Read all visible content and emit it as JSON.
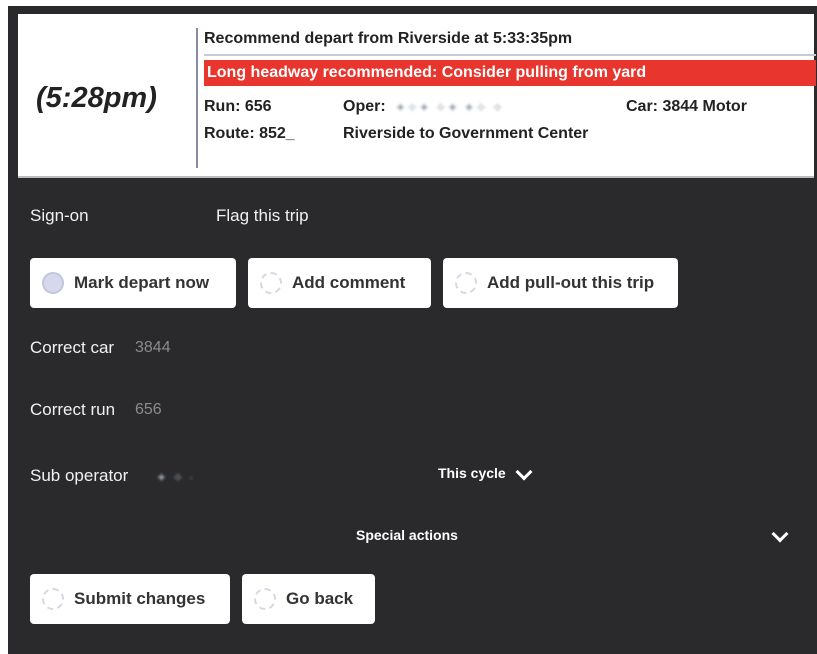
{
  "header": {
    "time": "(5:28pm)",
    "recommendation": "Recommend depart from Riverside at 5:33:35pm",
    "alert": "Long headway recommended: Consider pulling from yard",
    "run": "Run: 656",
    "oper_label": "Oper:",
    "car": "Car: 3844 Motor",
    "route": "Route: 852_",
    "route_name": "Riverside to Government Center"
  },
  "menu": {
    "sign_on": "Sign-on",
    "flag_trip": "Flag this trip"
  },
  "actions": {
    "mark_depart": "Mark depart now",
    "add_comment": "Add comment",
    "add_pullout": "Add pull-out this trip"
  },
  "fields": {
    "correct_car_label": "Correct car",
    "correct_car_value": "3844",
    "correct_run_label": "Correct run",
    "correct_run_value": "656",
    "sub_operator_label": "Sub operator"
  },
  "cycle": {
    "label": "This cycle"
  },
  "special": {
    "label": "Special actions"
  },
  "footer": {
    "submit": "Submit changes",
    "go_back": "Go back"
  },
  "colors": {
    "panel": "#2a2a2c",
    "alert": "#e8352e",
    "card": "#ffffff"
  },
  "icons": [
    "chevron-down-icon",
    "spinner-icon"
  ]
}
